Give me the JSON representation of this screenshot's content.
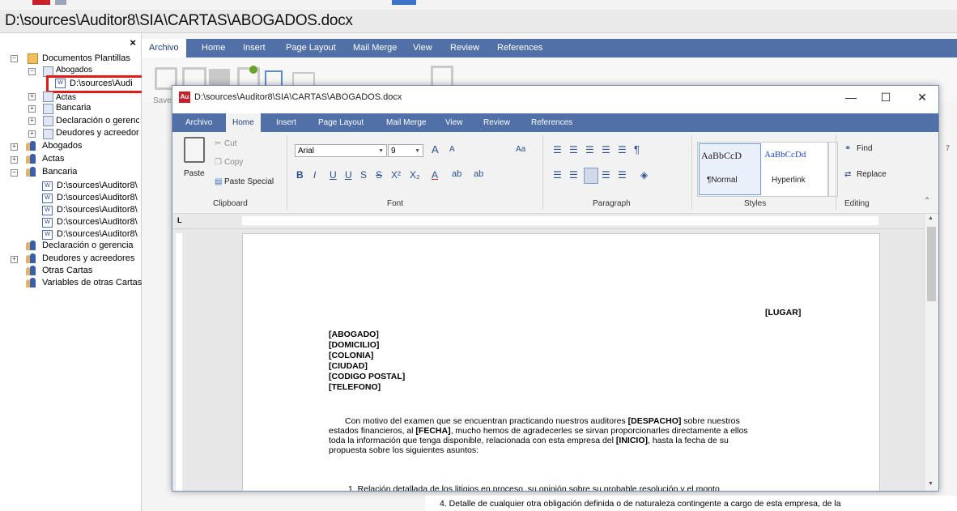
{
  "window_title": "D:\\sources\\Auditor8\\SIA\\CARTAS\\ABOGADOS.docx",
  "tree": {
    "close_glyph": "×",
    "items": [
      {
        "label": "Documentos Plantillas"
      },
      {
        "label": "Abogados"
      },
      {
        "label": "D:\\sources\\Audi"
      },
      {
        "label": "Actas"
      },
      {
        "label": "Bancaria"
      },
      {
        "label": "Declaración o gerenc"
      },
      {
        "label": "Deudores y acreedor"
      },
      {
        "label": "Abogados"
      },
      {
        "label": "Actas"
      },
      {
        "label": "Bancaria"
      },
      {
        "label": "D:\\sources\\Auditor8\\"
      },
      {
        "label": "D:\\sources\\Auditor8\\"
      },
      {
        "label": "D:\\sources\\Auditor8\\"
      },
      {
        "label": "D:\\sources\\Auditor8\\"
      },
      {
        "label": "D:\\sources\\Auditor8\\"
      },
      {
        "label": "Declaración o gerencia"
      },
      {
        "label": "Deudores y acreedores"
      },
      {
        "label": "Otras Cartas"
      },
      {
        "label": "Variables de otras Cartas"
      }
    ]
  },
  "bg_app": {
    "tabs": [
      "Archivo",
      "Home",
      "Insert",
      "Page Layout",
      "Mail Merge",
      "View",
      "Review",
      "References"
    ],
    "save_label": "Save",
    "right_digit": "7"
  },
  "dialog": {
    "app_icon": "Au",
    "title": "D:\\sources\\Auditor8\\SIA\\CARTAS\\ABOGADOS.docx",
    "min_glyph": "—",
    "max_glyph": "☐",
    "close_glyph": "✕",
    "tabs": [
      "Archivo",
      "Home",
      "Insert",
      "Page Layout",
      "Mail Merge",
      "View",
      "Review",
      "References"
    ],
    "ribbon": {
      "cut": "Cut",
      "copy": "Copy",
      "paste": "Paste",
      "paste_special": "Paste Special",
      "clipboard_group": "Clipboard",
      "font_name": "Arial",
      "font_size": "9",
      "font_group": "Font",
      "paragraph_group": "Paragraph",
      "style_normal_preview": "AaBbCcD",
      "style_normal": "¶Normal",
      "style_hyperlink_preview": "AaBbCcDd",
      "style_hyperlink": "Hyperlink",
      "styles_group": "Styles",
      "find": "Find",
      "replace": "Replace",
      "editing_group": "Editing"
    },
    "ruler_corner": "L",
    "document": {
      "lugar": "[LUGAR]",
      "address": [
        "[ABOGADO]",
        "[DOMICILIO]",
        "[COLONIA]",
        "[CIUDAD]",
        "[CODIGO POSTAL]",
        "[TELEFONO]"
      ],
      "para_l1_a": "Con motivo del examen que se encuentran practicando nuestros auditores ",
      "para_l1_b": "[DESPACHO]",
      "para_l1_c": " sobre nuestros",
      "para_l2_a": "estados financieros, al ",
      "para_l2_b": "[FECHA]",
      "para_l2_c": ", mucho hemos de agradecerles se sirvan  proporcionarles directamente a ellos",
      "para_l3_a": "toda la información que tenga disponible, relacionada con esta empresa del ",
      "para_l3_b": "[INICIO]",
      "para_l3_c": ", hasta la fecha de su",
      "para_l4": "propuesta sobre los siguientes asuntos:",
      "item1": "1.   Relación detallada de los litigios en proceso, su opinión sobre su probable resolución y el monto"
    }
  },
  "bottom_text": "4.    Detalle de cualquier otra obligación definida o de naturaleza contingente a cargo de esta empresa, de la",
  "colors": {
    "ribbon_blue": "#5070a7",
    "highlight_red": "#e21a1a"
  }
}
